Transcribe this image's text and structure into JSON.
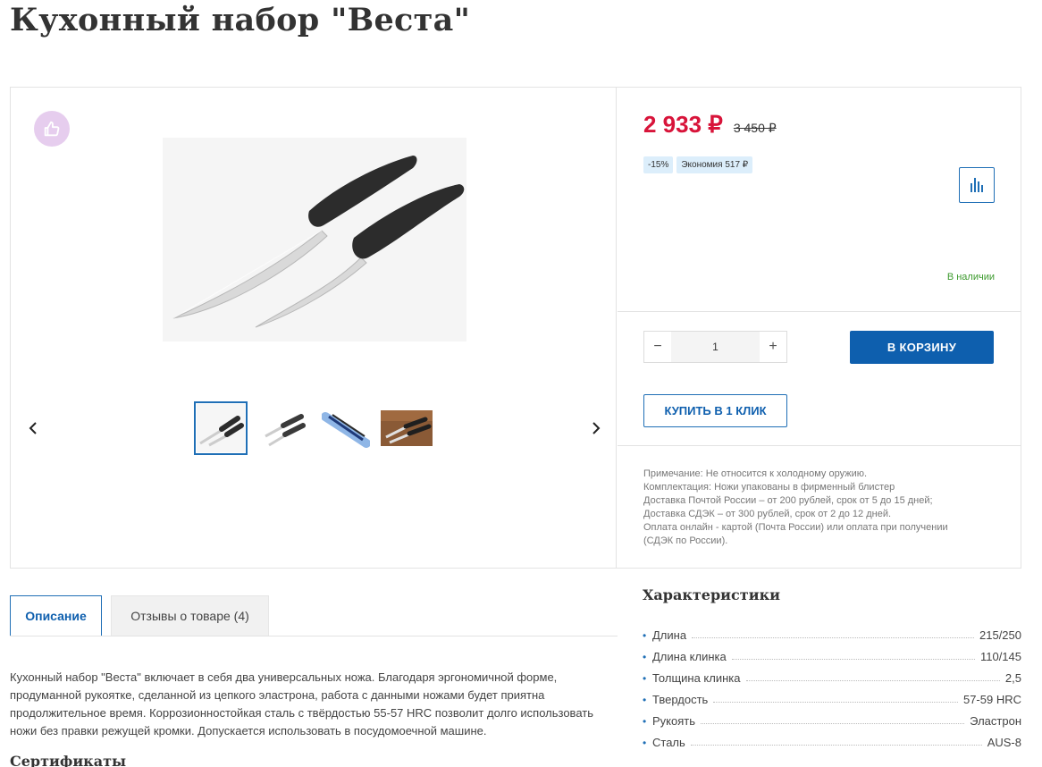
{
  "product": {
    "title": "Кухонный набор \"Веста\""
  },
  "gallery": {
    "thumbnails": [
      {
        "name": "thumb-1"
      },
      {
        "name": "thumb-2"
      },
      {
        "name": "thumb-3"
      },
      {
        "name": "thumb-4"
      }
    ],
    "icons": {
      "like": "thumbs-up-icon",
      "prev": "chevron-left-icon",
      "next": "chevron-right-icon"
    }
  },
  "pricing": {
    "current": "2 933 ₽",
    "old": "3 450 ₽",
    "discount_badge": "-15%",
    "savings_badge": "Экономия 517 ₽"
  },
  "stock": {
    "status": "В наличии"
  },
  "purchase": {
    "quantity": "1",
    "minus": "−",
    "plus": "+",
    "cart_button": "В КОРЗИНУ",
    "one_click_button": "КУПИТЬ В 1 КЛИК"
  },
  "notes": [
    "Примечание: Не относится к холодному оружию.",
    "Комплектация: Ножи упакованы в фирменный блистер",
    "Доставка Почтой России – от 200 рублей, срок от 5 до 15 дней;",
    "Доставка СДЭК – от 300 рублей, срок от 2 до 12 дней.",
    "Оплата онлайн - картой (Почта России) или оплата при получении",
    "(СДЭК по России)."
  ],
  "tabs": {
    "description": "Описание",
    "reviews": "Отзывы о товаре  (4)"
  },
  "description": "Кухонный набор \"Веста\" включает в себя два универсальных ножа. Благодаря эргономичной форме, продуманной рукоятке, сделанной из цепкого эластрона, работа с данными ножами будет приятна продолжительное время. Коррозионностойкая сталь с твёрдостью 55-57 HRC позволит долго использовать ножи без правки режущей кромки. Допускается использовать в посудомоечной машине.",
  "certificates_title": "Сертификаты",
  "specs": {
    "title": "Характеристики",
    "rows": [
      {
        "name": "Длина",
        "value": "215/250"
      },
      {
        "name": "Длина клинка",
        "value": "110/145"
      },
      {
        "name": "Толщина клинка",
        "value": "2,5"
      },
      {
        "name": "Твердость",
        "value": "57-59 HRC"
      },
      {
        "name": "Рукоять",
        "value": "Эластрон"
      },
      {
        "name": "Сталь",
        "value": "AUS-8"
      }
    ]
  },
  "colors": {
    "accent": "#0e5fae",
    "price": "#d8143a",
    "stock": "#3c9a2d",
    "like_bg": "#e6cdee"
  }
}
